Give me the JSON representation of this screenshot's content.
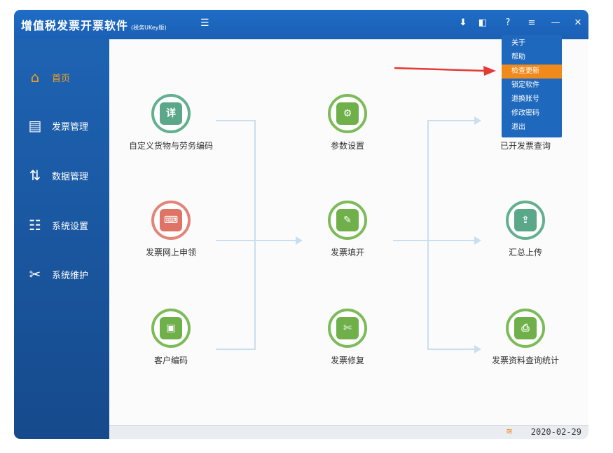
{
  "app": {
    "title": "增值税发票开票软件",
    "subtitle": "(税务UKey版)"
  },
  "titlebar": {
    "buttons": [
      {
        "name": "download-icon",
        "glyph": "⬇"
      },
      {
        "name": "lock-icon",
        "glyph": "◧"
      },
      {
        "name": "help-icon",
        "glyph": "?"
      },
      {
        "name": "menu-icon",
        "glyph": "≡"
      },
      {
        "name": "minimize-icon",
        "glyph": "—"
      },
      {
        "name": "close-icon",
        "glyph": "✕"
      }
    ]
  },
  "sidebar": {
    "items": [
      {
        "label": "首页",
        "icon": "home-icon",
        "glyph": "⌂",
        "active": true
      },
      {
        "label": "发票管理",
        "icon": "printer-icon",
        "glyph": "▤",
        "active": false
      },
      {
        "label": "数据管理",
        "icon": "data-icon",
        "glyph": "⇅",
        "active": false
      },
      {
        "label": "系统设置",
        "icon": "settings-icon",
        "glyph": "☷",
        "active": false
      },
      {
        "label": "系统维护",
        "icon": "tools-icon",
        "glyph": "✂",
        "active": false
      }
    ]
  },
  "menu": {
    "items": [
      "关于",
      "帮助",
      "检查更新",
      "锁定软件",
      "退换账号",
      "修改密码",
      "退出"
    ],
    "highlighted": "检查更新"
  },
  "flow": {
    "nodes": [
      {
        "id": "goods",
        "label": "自定义货物与劳务编码",
        "icon": "goods-code-icon",
        "glyph": "详",
        "color": "teal"
      },
      {
        "id": "apply",
        "label": "发票网上申领",
        "icon": "online-apply-icon",
        "glyph": "⌨",
        "color": "red"
      },
      {
        "id": "customer",
        "label": "客户编码",
        "icon": "customer-code-icon",
        "glyph": "▣",
        "color": "green"
      },
      {
        "id": "params",
        "label": "参数设置",
        "icon": "params-icon",
        "glyph": "⚙",
        "color": "green"
      },
      {
        "id": "issue",
        "label": "发票填开",
        "icon": "fill-invoice-icon",
        "glyph": "✎",
        "color": "green"
      },
      {
        "id": "repair",
        "label": "发票修复",
        "icon": "repair-icon",
        "glyph": "✄",
        "color": "green"
      },
      {
        "id": "query",
        "label": "已开发票查询",
        "icon": "query-icon",
        "glyph": "⌕",
        "color": "green"
      },
      {
        "id": "upload",
        "label": "汇总上传",
        "icon": "upload-icon",
        "glyph": "⇪",
        "color": "teal"
      },
      {
        "id": "stats",
        "label": "发票资料查询统计",
        "icon": "stats-icon",
        "glyph": "⎙",
        "color": "green"
      }
    ]
  },
  "status": {
    "date": "2020-02-29"
  }
}
